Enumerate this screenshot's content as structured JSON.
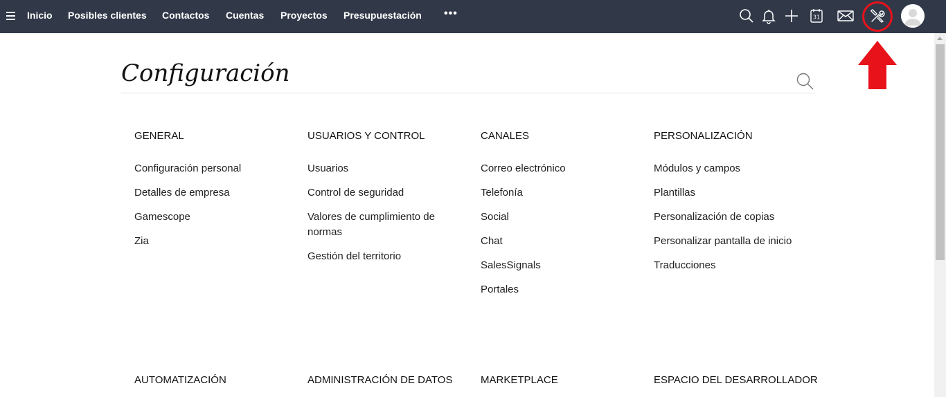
{
  "nav": {
    "menu_icon": "hamburger-menu-icon",
    "items": [
      {
        "label": "Inicio"
      },
      {
        "label": "Posibles clientes"
      },
      {
        "label": "Contactos"
      },
      {
        "label": "Cuentas"
      },
      {
        "label": "Proyectos"
      },
      {
        "label": "Presupuestación"
      }
    ],
    "more_label": "•••",
    "icons": [
      "search-icon",
      "bell-icon",
      "plus-icon",
      "calendar-icon",
      "mail-icon",
      "setup-tools-icon",
      "avatar"
    ],
    "calendar_day": "31"
  },
  "colors": {
    "topbar": "#313949",
    "highlight": "#e8121b"
  },
  "page": {
    "title": "Configuración"
  },
  "sections": [
    {
      "heading": "GENERAL",
      "items": [
        "Configuración personal",
        "Detalles de empresa",
        "Gamescope",
        "Zia"
      ]
    },
    {
      "heading": "USUARIOS Y CONTROL",
      "items": [
        "Usuarios",
        "Control de seguridad",
        "Valores de cumplimiento de normas",
        "Gestión del territorio"
      ]
    },
    {
      "heading": "CANALES",
      "items": [
        "Correo electrónico",
        "Telefonía",
        "Social",
        "Chat",
        "SalesSignals",
        "Portales"
      ]
    },
    {
      "heading": "PERSONALIZACIÓN",
      "items": [
        "Módulos y campos",
        "Plantillas",
        "Personalización de copias",
        "Personalizar pantalla de inicio",
        "Traducciones"
      ]
    }
  ],
  "sections_row2": [
    {
      "heading": "AUTOMATIZACIÓN"
    },
    {
      "heading": "ADMINISTRACIÓN DE DATOS"
    },
    {
      "heading": "MARKETPLACE"
    },
    {
      "heading": "ESPACIO DEL DESARROLLADOR"
    }
  ]
}
